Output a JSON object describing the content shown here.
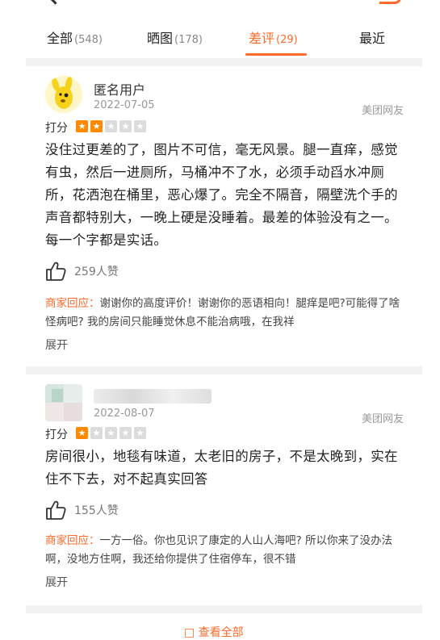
{
  "tabs": [
    {
      "label": "全部",
      "count": "(548)"
    },
    {
      "label": "晒图",
      "count": "(178)"
    },
    {
      "label": "差评",
      "count": "(29)"
    },
    {
      "label": "最近",
      "count": ""
    }
  ],
  "colors": {
    "accent": "#ff6a2a",
    "star_on": "#ff8a00",
    "star_off": "#dcdcdc"
  },
  "reviews": [
    {
      "username": "匿名用户",
      "date": "2022-07-05",
      "source": "美团网友",
      "rating_label": "打分",
      "rating": 2,
      "rating_max": 5,
      "content": "没住过更差的了，图片不可信，毫无风景。腿一直痒，感觉有虫，然后一进厕所，马桶冲不了水，必须手动舀水冲厕所，花洒泡在桶里，恶心爆了。完全不隔音，隔壁洗个手的声音都特别大，一晚上硬是没睡着。最差的体验没有之一。每一个字都是实话。",
      "likes": "259人赞",
      "reply_label": "商家回应：",
      "reply": "谢谢你的高度评价！谢谢你的恶语相向！腿痒是吧?可能得了啥怪病吧? 我的房间只能睡觉休息不能治病哦，在我祥",
      "expand": "展开"
    },
    {
      "username": "",
      "date": "2022-08-07",
      "source": "美团网友",
      "rating_label": "打分",
      "rating": 1,
      "rating_max": 5,
      "content": "房间很小，地毯有味道，太老旧的房子，不是太晚到，实在住不下去，对不起真实回答",
      "likes": "155人赞",
      "reply_label": "商家回应：",
      "reply": "一方一俗。你也见识了康定的人山人海吧? 所以你来了没办法啊，没地方住啊，我还给你提供了住宿停车，很不错",
      "expand": "展开"
    }
  ],
  "bottom_text": "□ 查看全部"
}
